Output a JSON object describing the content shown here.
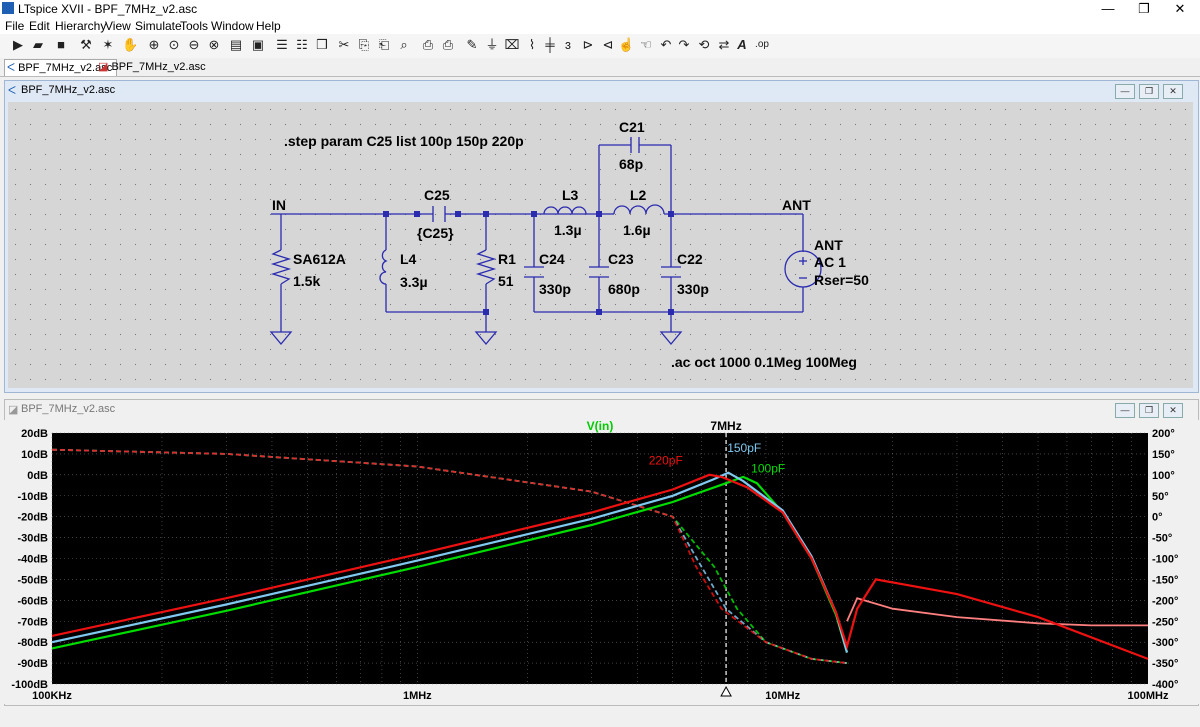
{
  "titlebar": {
    "title": "LTspice XVII - BPF_7MHz_v2.asc",
    "min": "—",
    "max": "❐",
    "close": "✕"
  },
  "menu": [
    "File",
    "Edit",
    "Hierarchy",
    "View",
    "Simulate",
    "Tools",
    "Window",
    "Help"
  ],
  "tabs": [
    "BPF_7MHz_v2.asc",
    "BPF_7MHz_v2.asc"
  ],
  "schematic_window": {
    "title": "BPF_7MHz_v2.asc"
  },
  "waveform_window": {
    "title": "BPF_7MHz_v2.asc"
  },
  "schematic": {
    "step_directive": ".step param C25 list 100p 150p 220p",
    "ac_directive": ".ac oct 1000 0.1Meg 100Meg",
    "labels": {
      "in": "IN",
      "ant_net": "ANT",
      "c21": "C21",
      "c21_val": "68p",
      "c25": "C25",
      "c25_val": "{C25}",
      "l3": "L3",
      "l3_val": "1.3µ",
      "l2": "L2",
      "l2_val": "1.6µ",
      "sa": "SA612A",
      "sa_val": "1.5k",
      "l4": "L4",
      "l4_val": "3.3µ",
      "r1": "R1",
      "r1_val": "51",
      "c24": "C24",
      "c24_val": "330p",
      "c23": "C23",
      "c23_val": "680p",
      "c22": "C22",
      "c22_val": "330p",
      "ant": "ANT",
      "ac": "AC 1",
      "rser": "Rser=50"
    }
  },
  "chart_data": {
    "type": "line",
    "trace_title": "V(in)",
    "cursor_label": "7MHz",
    "x_scale": "log",
    "xlim": [
      100000,
      100000000
    ],
    "x_tick_labels": [
      "100KHz",
      "1MHz",
      "10MHz",
      "100MHz"
    ],
    "x_tick_values": [
      100000,
      1000000,
      10000000,
      100000000
    ],
    "ylim_left": [
      -100,
      20
    ],
    "y_left_ticks": [
      "20dB",
      "10dB",
      "0dB",
      "-10dB",
      "-20dB",
      "-30dB",
      "-40dB",
      "-50dB",
      "-60dB",
      "-70dB",
      "-80dB",
      "-90dB",
      "-100dB"
    ],
    "ylim_right": [
      -400,
      200
    ],
    "y_right_ticks": [
      "200°",
      "150°",
      "100°",
      "50°",
      "0°",
      "-50°",
      "-100°",
      "-150°",
      "-200°",
      "-250°",
      "-300°",
      "-350°",
      "-400°"
    ],
    "cursor_x": 7000000,
    "background": "#000000",
    "grid_color": "#6a6a6a",
    "series": [
      {
        "name": "100pF",
        "color": "#00dd00",
        "magnitude": [
          [
            100000,
            -83
          ],
          [
            300000,
            -65
          ],
          [
            1000000,
            -44
          ],
          [
            3000000,
            -24
          ],
          [
            5000000,
            -13
          ],
          [
            7000000,
            -4
          ],
          [
            7800000,
            -1
          ],
          [
            8500000,
            -4
          ],
          [
            10000000,
            -18
          ],
          [
            12000000,
            -40
          ],
          [
            14000000,
            -67
          ],
          [
            15000000,
            -85
          ]
        ],
        "phase": [
          [
            100000,
            160
          ],
          [
            300000,
            150
          ],
          [
            1000000,
            120
          ],
          [
            3000000,
            60
          ],
          [
            5000000,
            0
          ],
          [
            6500000,
            -120
          ],
          [
            7500000,
            -220
          ],
          [
            9000000,
            -300
          ],
          [
            12000000,
            -340
          ],
          [
            15000000,
            -350
          ]
        ]
      },
      {
        "name": "150pF",
        "color": "#7fc8f0",
        "magnitude": [
          [
            100000,
            -80
          ],
          [
            300000,
            -62
          ],
          [
            1000000,
            -41
          ],
          [
            3000000,
            -21
          ],
          [
            5000000,
            -10
          ],
          [
            6500000,
            -2
          ],
          [
            7100000,
            1
          ],
          [
            7800000,
            -3
          ],
          [
            10000000,
            -17
          ],
          [
            12000000,
            -39
          ],
          [
            14000000,
            -66
          ],
          [
            15000000,
            -85
          ]
        ],
        "phase": [
          [
            100000,
            160
          ],
          [
            300000,
            150
          ],
          [
            1000000,
            120
          ],
          [
            3000000,
            60
          ],
          [
            5000000,
            0
          ],
          [
            6000000,
            -120
          ],
          [
            7000000,
            -220
          ],
          [
            9000000,
            -300
          ],
          [
            12000000,
            -340
          ],
          [
            15000000,
            -350
          ]
        ]
      },
      {
        "name": "220pF",
        "color": "#ee1111",
        "magnitude": [
          [
            100000,
            -77
          ],
          [
            300000,
            -59
          ],
          [
            1000000,
            -38
          ],
          [
            3000000,
            -18
          ],
          [
            5000000,
            -7
          ],
          [
            6300000,
            0
          ],
          [
            6800000,
            -1
          ],
          [
            8000000,
            -6
          ],
          [
            10000000,
            -18
          ],
          [
            12000000,
            -40
          ],
          [
            14000000,
            -66
          ],
          [
            15000000,
            -82
          ],
          [
            16000000,
            -64
          ],
          [
            18000000,
            -50
          ],
          [
            30000000,
            -57
          ],
          [
            50000000,
            -68
          ],
          [
            100000000,
            -88
          ]
        ],
        "phase": [
          [
            100000,
            160
          ],
          [
            300000,
            150
          ],
          [
            1000000,
            120
          ],
          [
            3000000,
            60
          ],
          [
            5000000,
            0
          ],
          [
            5800000,
            -120
          ],
          [
            6800000,
            -220
          ],
          [
            9000000,
            -300
          ],
          [
            12000000,
            -340
          ],
          [
            15000000,
            -350
          ]
        ]
      }
    ],
    "common_stopband": [
      [
        15000000,
        -70
      ],
      [
        16000000,
        -59
      ],
      [
        20000000,
        -64
      ],
      [
        30000000,
        -68
      ],
      [
        50000000,
        -71
      ],
      [
        70000000,
        -72
      ],
      [
        100000000,
        -72
      ]
    ]
  }
}
